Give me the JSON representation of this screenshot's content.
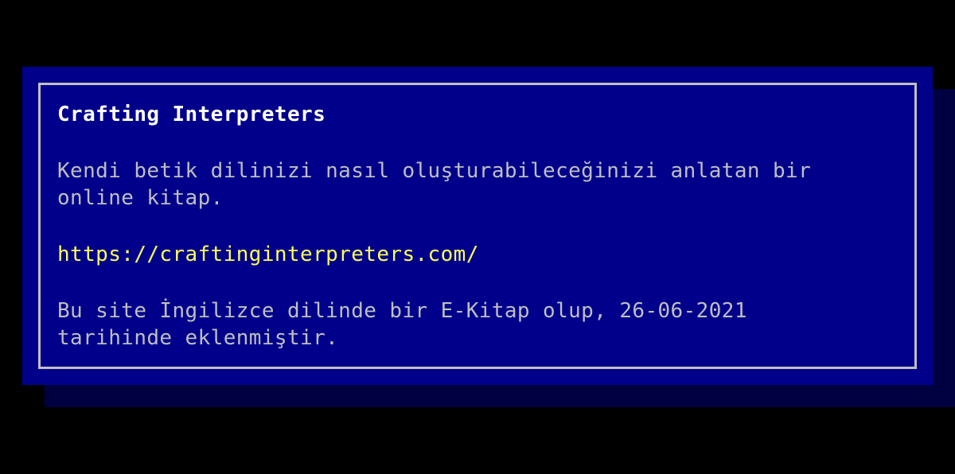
{
  "dialog": {
    "title": "Crafting Interpreters",
    "description": "Kendi betik dilinizi nasıl oluşturabileceğinizi anlatan bir\nonline kitap.",
    "link": "https://craftinginterpreters.com/",
    "note": "Bu site İngilizce dilinde bir E-Kitap olup, 26-06-2021\ntarihinde eklenmiştir."
  },
  "colors": {
    "background": "#000000",
    "dialog": "#00008b",
    "shadow": "#000040",
    "border": "#c0c0c0",
    "title": "#ffffff",
    "text": "#bfbfbf",
    "link": "#ffff55"
  }
}
